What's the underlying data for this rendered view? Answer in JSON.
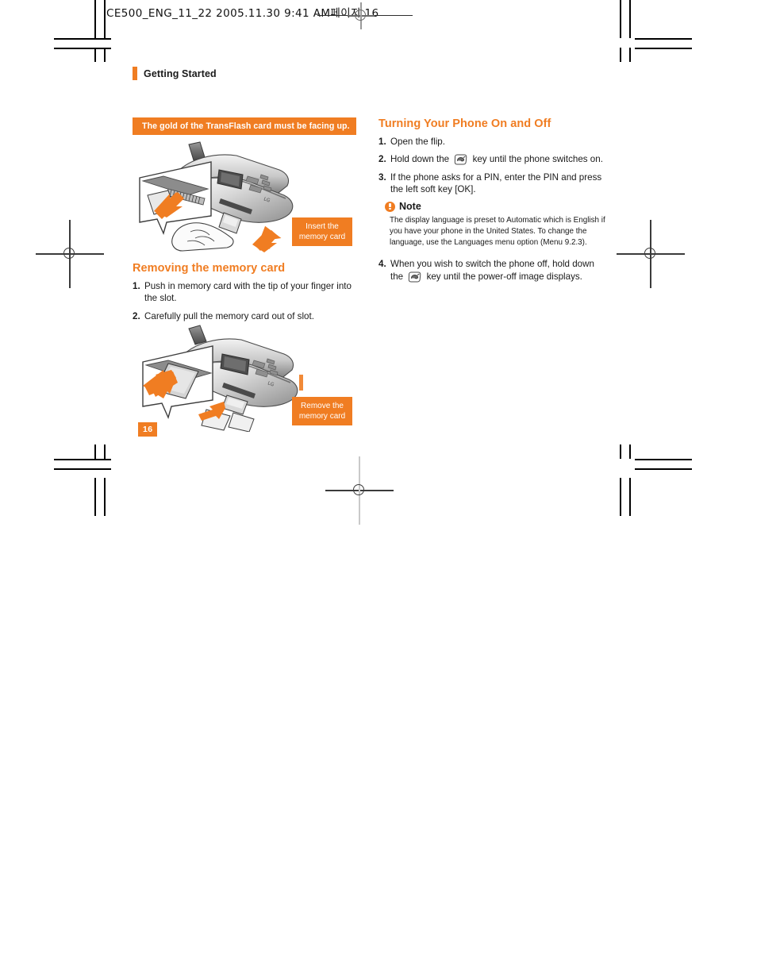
{
  "print_header": {
    "text": "CE500_ENG_11_22  2005.11.30  9:41 AM페이지 16"
  },
  "section": {
    "label": "Getting Started"
  },
  "colors": {
    "accent": "#f07d22",
    "text": "#1a1a1a",
    "white": "#ffffff"
  },
  "left_column": {
    "banner": "The gold of the TransFlash card must be facing up.",
    "illustration_insert": {
      "name": "phone-memory-card-insert-illustration",
      "callout": "Insert the\nmemory card",
      "callout_line1": "Insert the",
      "callout_line2": "memory card"
    },
    "heading": "Removing the memory card",
    "steps": [
      {
        "num": "1.",
        "text": "Push in memory card with the tip of your finger into the slot."
      },
      {
        "num": "2.",
        "text": "Carefully pull the memory card out of slot."
      }
    ],
    "illustration_remove": {
      "name": "phone-memory-card-remove-illustration",
      "callout_line1": "Remove the",
      "callout_line2": "memory card"
    },
    "page_number": "16"
  },
  "right_column": {
    "heading": "Turning Your Phone On and Off",
    "steps": [
      {
        "num": "1.",
        "pre": "Open the flip.",
        "icon": null,
        "post": ""
      },
      {
        "num": "2.",
        "pre": "Hold down the ",
        "icon": "end-call-key-icon",
        "post": " key until the  phone switches on."
      },
      {
        "num": "3.",
        "pre": "If the phone asks for a PIN, enter the PIN and press the left soft key [OK].",
        "icon": null,
        "post": ""
      }
    ],
    "note": {
      "icon": "exclamation-circle-icon",
      "title": "Note",
      "body": "The display language is preset to Automatic which is English if you have your phone in the United States. To change the language, use the Languages menu option (Menu 9.2.3)."
    },
    "step4": {
      "num": "4.",
      "pre": "When you wish to switch the phone off, hold down the ",
      "icon": "end-call-key-icon",
      "post": " key until the power-off image displays."
    }
  }
}
